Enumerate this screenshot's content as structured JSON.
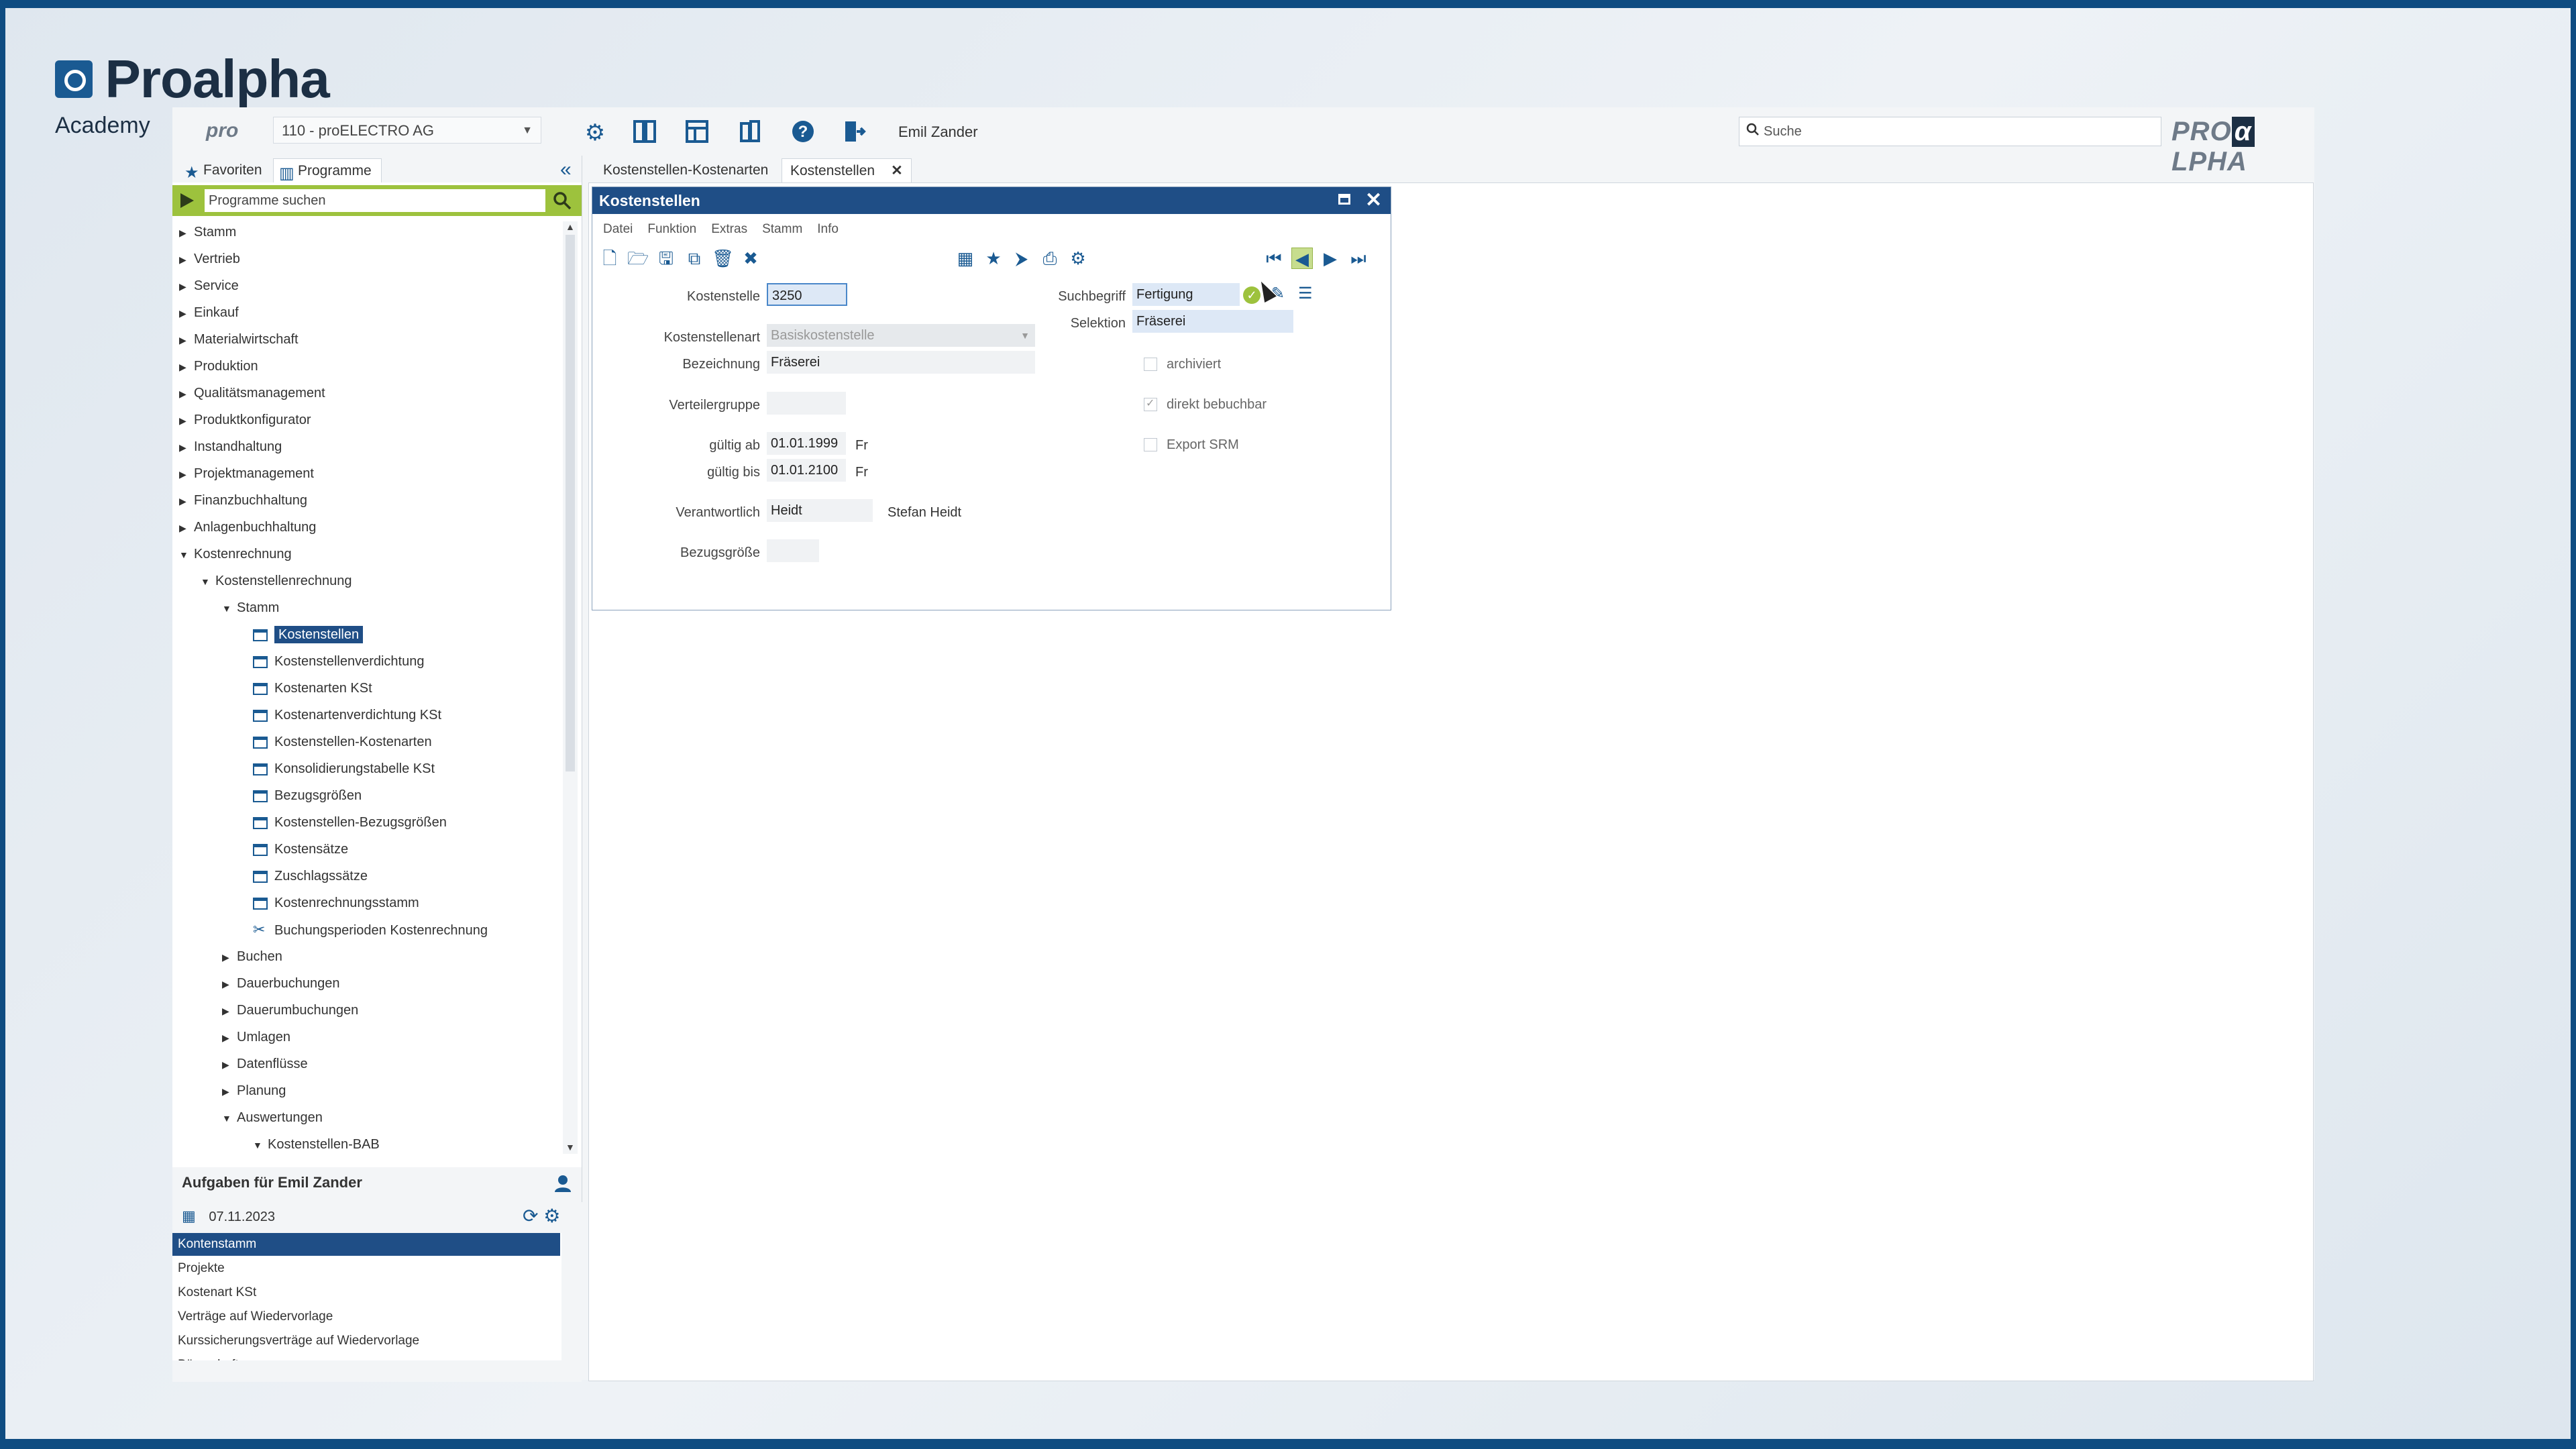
{
  "brand": {
    "name": "Proalpha",
    "subtitle": "Academy"
  },
  "topbar": {
    "pro_logo": "pro",
    "client": "110 - proELECTRO AG",
    "user": "Emil Zander",
    "search_placeholder": "Suche",
    "logo_left": "PRO",
    "logo_mark": "α",
    "logo_right": "LPHA",
    "icons": [
      "gear-icon",
      "panel-icon",
      "layout-icon",
      "book-icon",
      "help-icon",
      "exit-icon"
    ]
  },
  "left_tabs": {
    "favorites": "Favoriten",
    "programs": "Programme"
  },
  "program_search": {
    "placeholder": "Programme suchen"
  },
  "tree": [
    {
      "label": "Stamm",
      "level": 0,
      "caret": "right"
    },
    {
      "label": "Vertrieb",
      "level": 0,
      "caret": "right"
    },
    {
      "label": "Service",
      "level": 0,
      "caret": "right"
    },
    {
      "label": "Einkauf",
      "level": 0,
      "caret": "right"
    },
    {
      "label": "Materialwirtschaft",
      "level": 0,
      "caret": "right"
    },
    {
      "label": "Produktion",
      "level": 0,
      "caret": "right"
    },
    {
      "label": "Qualitätsmanagement",
      "level": 0,
      "caret": "right"
    },
    {
      "label": "Produktkonfigurator",
      "level": 0,
      "caret": "right"
    },
    {
      "label": "Instandhaltung",
      "level": 0,
      "caret": "right"
    },
    {
      "label": "Projektmanagement",
      "level": 0,
      "caret": "right"
    },
    {
      "label": "Finanzbuchhaltung",
      "level": 0,
      "caret": "right"
    },
    {
      "label": "Anlagenbuchhaltung",
      "level": 0,
      "caret": "right"
    },
    {
      "label": "Kostenrechnung",
      "level": 0,
      "caret": "down"
    },
    {
      "label": "Kostenstellenrechnung",
      "level": 1,
      "caret": "down"
    },
    {
      "label": "Stamm",
      "level": 2,
      "caret": "down"
    },
    {
      "label": "Kostenstellen",
      "level": 3,
      "icon": "doc",
      "selected": true
    },
    {
      "label": "Kostenstellenverdichtung",
      "level": 3,
      "icon": "doc"
    },
    {
      "label": "Kostenarten KSt",
      "level": 3,
      "icon": "doc"
    },
    {
      "label": "Kostenartenverdichtung KSt",
      "level": 3,
      "icon": "doc"
    },
    {
      "label": "Kostenstellen-Kostenarten",
      "level": 3,
      "icon": "doc"
    },
    {
      "label": "Konsolidierungstabelle KSt",
      "level": 3,
      "icon": "doc"
    },
    {
      "label": "Bezugsgrößen",
      "level": 3,
      "icon": "doc"
    },
    {
      "label": "Kostenstellen-Bezugsgrößen",
      "level": 3,
      "icon": "doc"
    },
    {
      "label": "Kostensätze",
      "level": 3,
      "icon": "doc"
    },
    {
      "label": "Zuschlagssätze",
      "level": 3,
      "icon": "doc"
    },
    {
      "label": "Kostenrechnungsstamm",
      "level": 3,
      "icon": "doc"
    },
    {
      "label": "Buchungsperioden Kostenrechnung",
      "level": 3,
      "icon": "wrench"
    },
    {
      "label": "Buchen",
      "level": 2,
      "caret": "right"
    },
    {
      "label": "Dauerbuchungen",
      "level": 2,
      "caret": "right"
    },
    {
      "label": "Dauerumbuchungen",
      "level": 2,
      "caret": "right"
    },
    {
      "label": "Umlagen",
      "level": 2,
      "caret": "right"
    },
    {
      "label": "Datenflüsse",
      "level": 2,
      "caret": "right"
    },
    {
      "label": "Planung",
      "level": 2,
      "caret": "right"
    },
    {
      "label": "Auswertungen",
      "level": 2,
      "caret": "down"
    },
    {
      "label": "Kostenstellen-BAB",
      "level": 3,
      "caret": "down"
    }
  ],
  "tasks": {
    "title": "Aufgaben für Emil Zander",
    "date": "07.11.2023",
    "items": [
      {
        "label": "Kontenstamm",
        "selected": true
      },
      {
        "label": "Projekte"
      },
      {
        "label": "Kostenart KSt"
      },
      {
        "label": "Verträge auf Wiedervorlage"
      },
      {
        "label": "Kurssicherungsverträge auf Wiedervorlage"
      },
      {
        "label": "Bürgschaften"
      }
    ]
  },
  "content_tabs": [
    {
      "label": "Kostenstellen-Kostenarten",
      "active": false
    },
    {
      "label": "Kostenstellen",
      "active": true
    }
  ],
  "dialog": {
    "title": "Kostenstellen",
    "menu": [
      "Datei",
      "Funktion",
      "Extras",
      "Stamm",
      "Info"
    ],
    "fields": {
      "kostenstelle": {
        "label": "Kostenstelle",
        "value": "3250"
      },
      "kostenstellenart": {
        "label": "Kostenstellenart",
        "value": "Basiskostenstelle"
      },
      "bezeichnung": {
        "label": "Bezeichnung",
        "value": "Fräserei"
      },
      "verteilergruppe": {
        "label": "Verteilergruppe",
        "value": ""
      },
      "gueltig_ab": {
        "label": "gültig ab",
        "value": "01.01.1999",
        "day": "Fr"
      },
      "gueltig_bis": {
        "label": "gültig bis",
        "value": "01.01.2100",
        "day": "Fr"
      },
      "verantwortlich": {
        "label": "Verantwortlich",
        "value": "Heidt",
        "name": "Stefan Heidt"
      },
      "bezugsgroesse": {
        "label": "Bezugsgröße",
        "value": ""
      },
      "suchbegriff": {
        "label": "Suchbegriff",
        "value": "Fertigung"
      },
      "selektion": {
        "label": "Selektion",
        "value": "Fräserei"
      }
    },
    "checkboxes": {
      "archiviert": {
        "label": "archiviert",
        "checked": false
      },
      "direkt_bebuchbar": {
        "label": "direkt bebuchbar",
        "checked": true
      },
      "export_srm": {
        "label": "Export SRM",
        "checked": false
      }
    }
  }
}
